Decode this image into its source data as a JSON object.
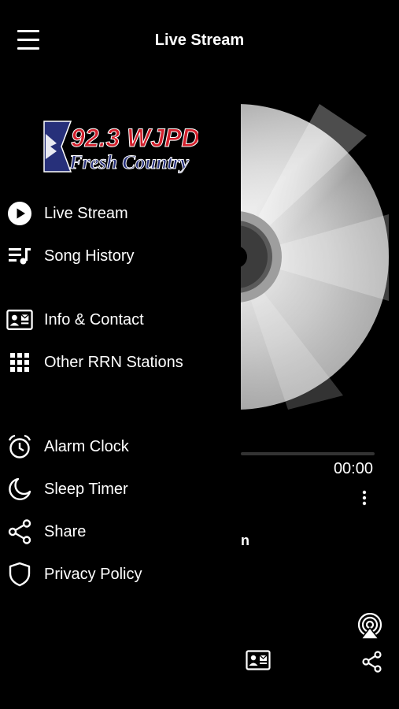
{
  "header": {
    "title": "Live Stream"
  },
  "logo": {
    "line1": "92.3 WJPD",
    "line2": "Fresh Country"
  },
  "menu": [
    {
      "label": "Live Stream",
      "icon": "play-circle-icon"
    },
    {
      "label": "Song History",
      "icon": "song-history-icon"
    },
    {
      "label": "Info & Contact",
      "icon": "contact-card-icon"
    },
    {
      "label": "Other RRN Stations",
      "icon": "grid-icon"
    },
    {
      "label": "Alarm Clock",
      "icon": "alarm-clock-icon"
    },
    {
      "label": "Sleep Timer",
      "icon": "moon-icon"
    },
    {
      "label": "Share",
      "icon": "share-icon"
    },
    {
      "label": "Privacy Policy",
      "icon": "shield-icon"
    }
  ],
  "player": {
    "time": "00:00",
    "track_partial": "n",
    "progress": 0
  },
  "colors": {
    "background": "#000000",
    "logo_red": "#d21f2b",
    "logo_blue": "#27307a"
  }
}
